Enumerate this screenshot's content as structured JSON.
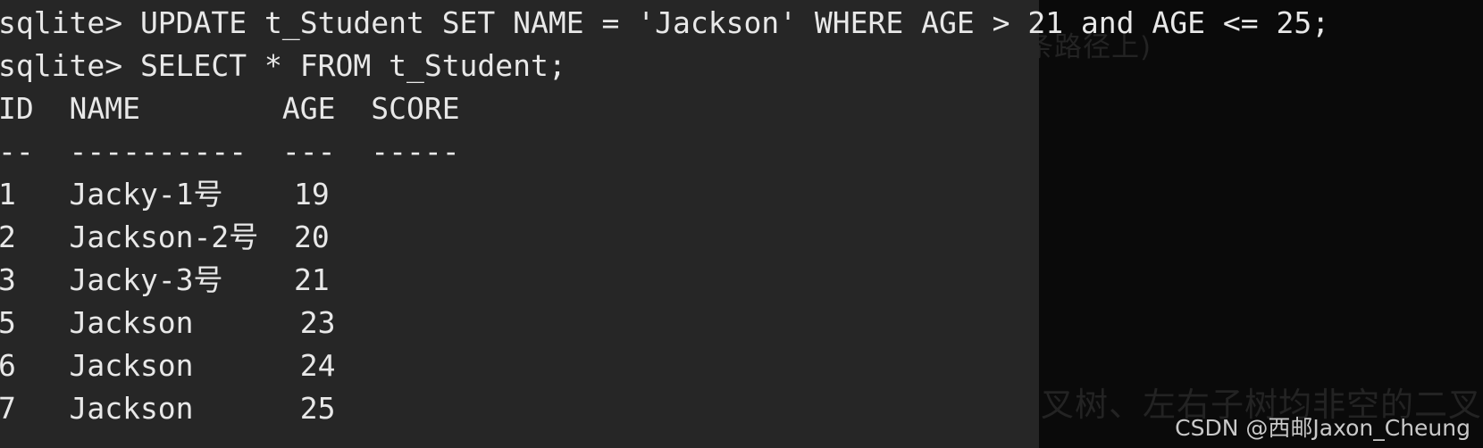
{
  "terminal": {
    "prompt": "sqlite>",
    "commands": [
      "sqlite> UPDATE t_Student SET NAME = 'Jackson' WHERE AGE > 21 and AGE <= 25;",
      "sqlite> SELECT * FROM t_Student;"
    ],
    "result_table": {
      "headers": [
        "ID",
        "NAME",
        "AGE",
        "SCORE"
      ],
      "header_line": "ID  NAME        AGE  SCORE",
      "separator_line": "--  ----------  ---  -----",
      "rows": [
        {
          "id": "1",
          "name": "Jacky-1号",
          "age": "19",
          "score": "",
          "line": "1   Jacky-1号    19"
        },
        {
          "id": "2",
          "name": "Jackson-2号",
          "age": "20",
          "score": "",
          "line": "2   Jackson-2号  20"
        },
        {
          "id": "3",
          "name": "Jacky-3号",
          "age": "21",
          "score": "",
          "line": "3   Jacky-3号    21"
        },
        {
          "id": "5",
          "name": "Jackson",
          "age": "23",
          "score": "",
          "line": "5   Jackson      23"
        },
        {
          "id": "6",
          "name": "Jackson",
          "age": "24",
          "score": "",
          "line": "6   Jackson      24"
        },
        {
          "id": "7",
          "name": "Jackson",
          "age": "25",
          "score": "",
          "line": "7   Jackson      25"
        }
      ]
    },
    "colors": {
      "background": "#262626",
      "foreground": "#e8e8e8"
    }
  },
  "background_page": {
    "text_top": "条路径上)",
    "text_bottom": "叉树、左右子树均非空的二叉树",
    "color": "#232323",
    "page_background": "#0a0a0a"
  },
  "watermark": {
    "text": "CSDN @西邮Jaxon_Cheung"
  }
}
